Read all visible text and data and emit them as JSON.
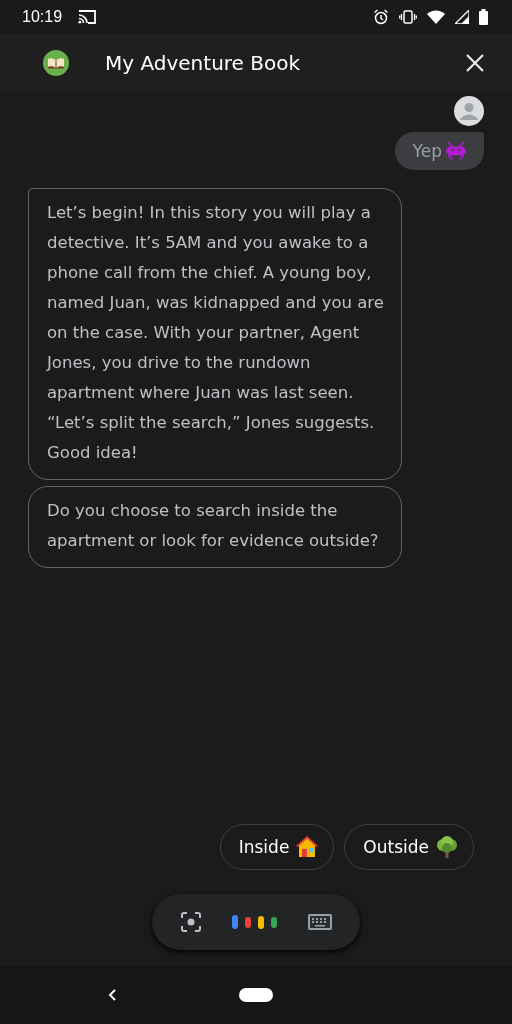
{
  "status_bar": {
    "time": "10:19"
  },
  "header": {
    "title": "My Adventure Book"
  },
  "messages": [
    {
      "kind": "user",
      "text": "Yep"
    },
    {
      "kind": "bot",
      "text": "Let’s begin! In this story you will play a detective. It’s 5AM and you awake to a phone call from the chief. A young boy, named Juan, was kidnapped and you are on the case. With your partner, Agent Jones, you drive to the rundown apartment where Juan was last seen. “Let’s split the search,” Jones suggests. Good idea!"
    },
    {
      "kind": "bot",
      "text": "Do you choose to search inside the apartment or look for evidence outside?"
    }
  ],
  "suggestions": [
    {
      "label": "Inside",
      "kind": "house"
    },
    {
      "label": "Outside",
      "kind": "tree"
    }
  ]
}
